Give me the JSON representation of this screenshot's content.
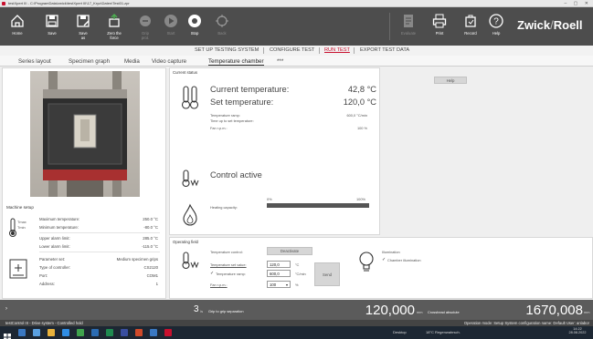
{
  "window": {
    "title": "testXpert III - C:\\ProgramData\\zwick\\testXpert III\\17_Kryo\\Daten\\Test01.zpr"
  },
  "toolbar": {
    "buttons": [
      {
        "label": "Home",
        "icon": "home-icon",
        "enabled": true
      },
      {
        "label": "Save",
        "icon": "save-icon",
        "enabled": true
      },
      {
        "label": "Save\nas",
        "icon": "save-as-icon",
        "enabled": true
      },
      {
        "label": "Zero the\nforce",
        "icon": "zero-force-icon",
        "enabled": true
      },
      {
        "label": "Grip\nprot.",
        "icon": "grip-icon",
        "enabled": false
      },
      {
        "label": "Start",
        "icon": "play-icon",
        "enabled": false
      },
      {
        "label": "Stop",
        "icon": "stop-icon",
        "enabled": true
      },
      {
        "label": "Back",
        "icon": "back-icon",
        "enabled": false
      }
    ],
    "right_buttons": [
      {
        "label": "Evaluate",
        "icon": "evaluate-icon",
        "enabled": false
      },
      {
        "label": "Print",
        "icon": "printer-icon",
        "enabled": true
      },
      {
        "label": "Record",
        "icon": "record-icon",
        "enabled": true
      },
      {
        "label": "Help",
        "icon": "help-icon",
        "enabled": true
      }
    ],
    "logo_main": "Zwick",
    "logo_sep": "/",
    "logo_rest": "Roell"
  },
  "process_tabs": [
    "SET UP TESTING SYSTEM",
    "CONFIGURE TEST",
    "RUN TEST",
    "EXPORT TEST DATA"
  ],
  "process_active": "RUN TEST",
  "sub_tabs": [
    "Series layout",
    "Specimen graph",
    "Media",
    "Video capture",
    "Temperature chamber",
    "***"
  ],
  "sub_active": "Temperature chamber",
  "machine_setup": {
    "title": "Machine setup",
    "rows": [
      {
        "label": "Maximum temperature:",
        "value": "250.0 °C"
      },
      {
        "label": "Minimum temperature:",
        "value": "-80.0 °C"
      },
      {
        "label": "Upper alarm limit:",
        "value": "285.0 °C"
      },
      {
        "label": "Lower alarm limit:",
        "value": "-115.0 °C"
      },
      {
        "label": "Parameter set:",
        "value": "Medium specimen grips"
      },
      {
        "label": "Type of controller:",
        "value": "CS2120"
      },
      {
        "label": "Port:",
        "value": "COM1"
      },
      {
        "label": "Address:",
        "value": "1"
      }
    ],
    "icon_max": "Tmax",
    "icon_min": "Tmin"
  },
  "current_status": {
    "title": "Current status",
    "help_label": "Help",
    "current_temp_label": "Current temperature:",
    "current_temp_value": "42,8 °C",
    "set_temp_label": "Set temperature:",
    "set_temp_value": "120,0 °C",
    "details": [
      {
        "label": "Temperature ramp:",
        "value": "600,0 °C/min"
      },
      {
        "label": "Time up to set temperature:",
        "value": ""
      },
      {
        "label": "Fan r.p.m.:",
        "value": "100 %"
      }
    ],
    "control_label": "Control active",
    "heating_label": "Heating capacity:",
    "heating_min": "0%",
    "heating_max": "100%",
    "heating_fraction": 0.0
  },
  "operating_field": {
    "title": "Operating field",
    "temp_control_label": "Temperature control:",
    "deactivate_label": "Deactivate",
    "set_value_label": "Temperature set value:",
    "set_value": "120,0",
    "set_value_unit": "°C",
    "ramp_label": "Temperature ramp:",
    "ramp_checked": true,
    "ramp_value": "600,0",
    "ramp_unit": "°C/min",
    "send_label": "Send",
    "fan_label": "Fan r.p.m.:",
    "fan_value": "100",
    "fan_unit": "%",
    "illumination_title": "Illumination",
    "chamber_illum_label": "Chamber illumination",
    "chamber_illum_checked": true
  },
  "status_bar": {
    "step_number": "3",
    "step_unit": "/s",
    "step_text": "Grip to grip separation",
    "force_value": "120,000",
    "force_unit": "mm",
    "crosshead_label": "Crosshead absolute",
    "position_value": "1670,008",
    "position_unit": "mm"
  },
  "info_line": {
    "left": "testControl III - Drive system - Controlled hold",
    "right": "Operation mode: Setup   System configuration name: Default   User: anlabor"
  },
  "taskbar": {
    "desktop": "Desktop",
    "weather": "18°C Regenwahrsch.",
    "time": "14:22",
    "date": "28.08.2022"
  },
  "colors": {
    "accent": "#c8102e",
    "toolbar": "#4d4d4d",
    "status": "#5b5b5b"
  }
}
